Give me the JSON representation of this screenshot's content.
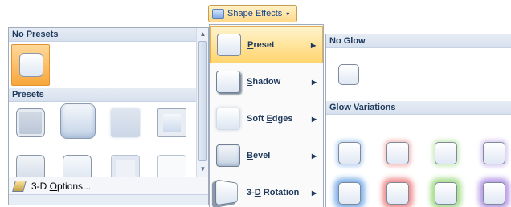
{
  "ribbon": {
    "shape_effects_label": "Shape Effects"
  },
  "gallery": {
    "no_presets_header": "No Presets",
    "presets_header": "Presets",
    "options_label_pre": "3-D ",
    "options_label_u": "O",
    "options_label_post": "ptions...",
    "grip_text": "...."
  },
  "menu": {
    "items": [
      {
        "pre": "",
        "u": "P",
        "post": "reset"
      },
      {
        "pre": "",
        "u": "S",
        "post": "hadow"
      },
      {
        "pre": "Soft ",
        "u": "E",
        "post": "dges"
      },
      {
        "pre": "",
        "u": "B",
        "post": "evel"
      },
      {
        "pre": "3-",
        "u": "D",
        "post": " Rotation"
      }
    ],
    "selected": "Preset"
  },
  "glow_panel": {
    "no_glow_header": "No Glow",
    "variations_header": "Glow Variations",
    "glow_colors": [
      "blue",
      "red",
      "green",
      "purple"
    ]
  },
  "colors": {
    "accent_orange": "#f8a63a",
    "hover_yellow": "#ffd56e",
    "glow_blue": "#7fb0ea",
    "glow_red": "#f08c8c",
    "glow_green": "#a6dd8c",
    "glow_purple": "#b89be6"
  }
}
